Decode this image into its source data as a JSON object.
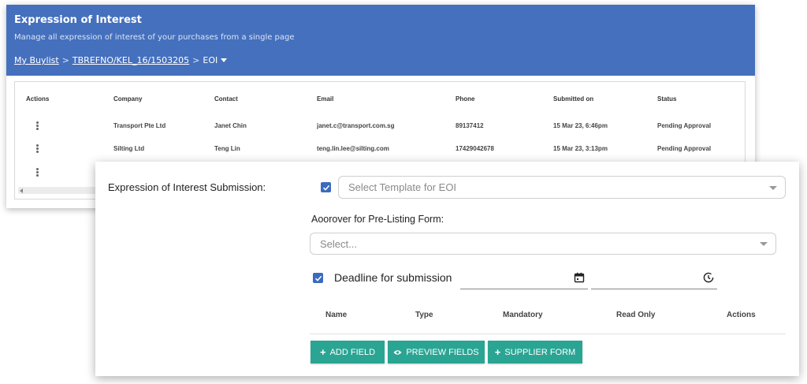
{
  "header": {
    "title": "Expression of Interest",
    "subtitle": "Manage all expression of interest of your purchases from a single page"
  },
  "breadcrumb": {
    "root": "My Buylist",
    "separator": ">",
    "ref": "TBREFNO/KEL_16/1503205",
    "current": "EOI"
  },
  "table": {
    "columns": [
      "Actions",
      "Company",
      "Contact",
      "Email",
      "Phone",
      "Submitted on",
      "Status"
    ],
    "rows": [
      {
        "company": "Transport Pte Ltd",
        "contact": "Janet Chin",
        "email": "janet.c@transport.com.sg",
        "phone": "89137412",
        "submitted": "15 Mar 23, 6:46pm",
        "status": "Pending Approval"
      },
      {
        "company": "Silting Ltd",
        "contact": "Teng Lin",
        "email": "teng.lin.lee@silting.com",
        "phone": "17429042678",
        "submitted": "15 Mar 23, 3:13pm",
        "status": "Pending Approval"
      }
    ]
  },
  "form": {
    "submission_label": "Expression of Interest Submission:",
    "template_placeholder": "Select Template for EOI",
    "approver_label": "Aoorover for Pre-Listing Form:",
    "approver_placeholder": "Select...",
    "deadline_label": "Deadline for submission",
    "field_columns": [
      "Name",
      "Type",
      "Mandatory",
      "Read Only",
      "Actions"
    ]
  },
  "buttons": {
    "add_field": "ADD FIELD",
    "preview_fields": "PREVIEW FIELDS",
    "supplier_form": "SUPPLIER FORM"
  },
  "colors": {
    "header_bg": "#4570bd",
    "checkbox": "#3a6bbf",
    "button": "#2aa593"
  },
  "icons": {
    "row_actions": "kebab-icon",
    "date": "calendar-icon",
    "time": "clock-icon",
    "add": "plus-icon",
    "preview": "eye-icon"
  }
}
